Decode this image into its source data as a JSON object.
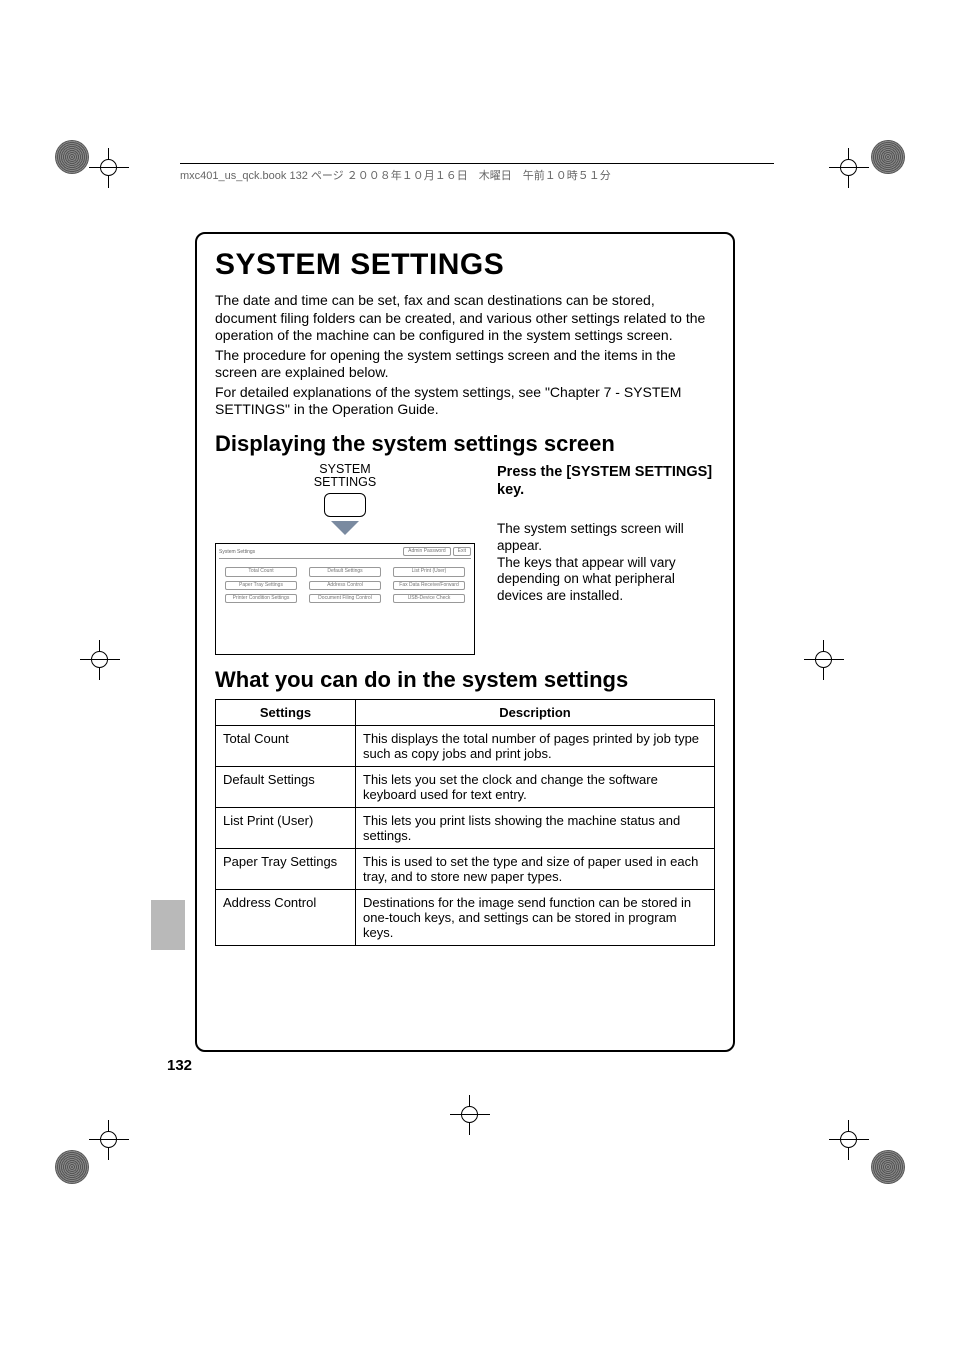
{
  "header_info": "mxc401_us_qck.book  132 ページ  ２００８年１０月１６日　木曜日　午前１０時５１分",
  "title": "SYSTEM SETTINGS",
  "intro": {
    "p1": "The date and time can be set, fax and scan destinations can be stored, document filing folders can be created, and various other settings related to the operation of the machine can be configured in the system settings screen.",
    "p2": "The procedure for opening the system settings screen and the items in the screen are explained below.",
    "p3": "For detailed explanations of the system settings, see \"Chapter 7 - SYSTEM SETTINGS\" in the Operation Guide."
  },
  "section1": {
    "heading": "Displaying the system settings screen",
    "key_label_line1": "SYSTEM",
    "key_label_line2": "SETTINGS",
    "screen_title": "System Settings",
    "top_buttons": {
      "admin": "Admin Password",
      "exit": "Exit"
    },
    "screen_buttons": [
      "Total Count",
      "Default Settings",
      "List Print (User)",
      "Paper Tray Settings",
      "Address Control",
      "Fax Data Receive/Forward",
      "Printer Condition Settings",
      "Document Filing Control",
      "USB-Device Check"
    ],
    "instruction_title": "Press the [SYSTEM SETTINGS] key.",
    "instruction_p1": "The system settings screen will appear.",
    "instruction_p2": "The keys that appear will vary depending on what peripheral devices are installed."
  },
  "section2": {
    "heading": "What you can do in the system settings",
    "col_settings": "Settings",
    "col_desc": "Description",
    "rows": [
      {
        "s": "Total Count",
        "d": "This displays the total number of pages printed by job type such as copy jobs and print jobs."
      },
      {
        "s": "Default Settings",
        "d": "This lets you set the clock and change the software keyboard used for text entry."
      },
      {
        "s": "List Print (User)",
        "d": "This lets you print lists showing the machine status and settings."
      },
      {
        "s": "Paper Tray Settings",
        "d": "This is used to set the type and size of paper used in each tray, and to store new paper types."
      },
      {
        "s": "Address Control",
        "d": "Destinations for the image send function can be stored in one-touch keys, and settings can be stored in program keys."
      }
    ]
  },
  "page_number": "132"
}
